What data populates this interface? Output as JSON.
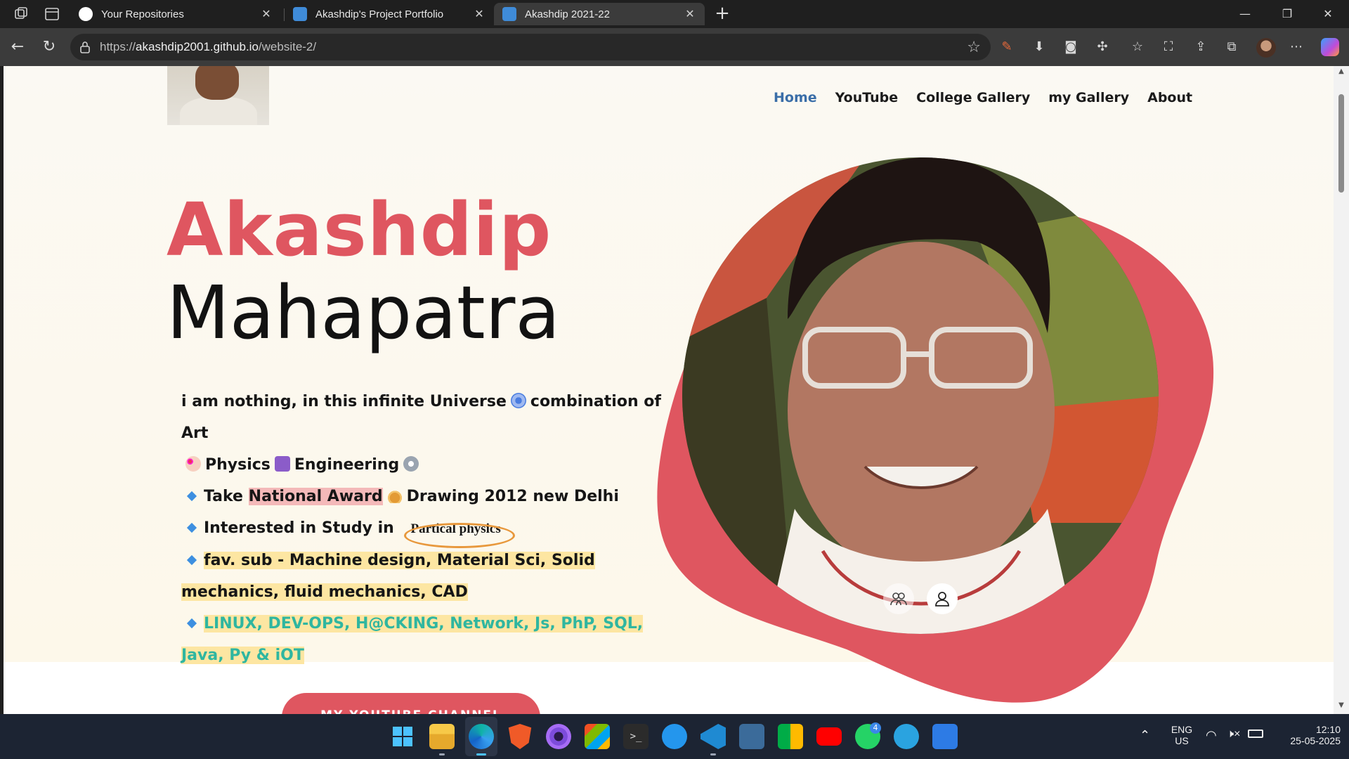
{
  "browser": {
    "tabs": [
      {
        "title": "Your Repositories",
        "active": false
      },
      {
        "title": "Akashdip's Project Portfolio",
        "active": false
      },
      {
        "title": "Akashdip 2021-22",
        "active": true
      }
    ],
    "url_scheme": "https://",
    "url_host": "akashdip2001.github.io",
    "url_path": "/website-2/"
  },
  "site": {
    "nav": [
      {
        "label": "Home",
        "active": true
      },
      {
        "label": "YouTube",
        "active": false
      },
      {
        "label": "College Gallery",
        "active": false
      },
      {
        "label": "my Gallery",
        "active": false
      },
      {
        "label": "About",
        "active": false
      }
    ],
    "name_first": "Akashdip",
    "name_last": "Mahapatra",
    "bio": {
      "line1": "i am nothing, in this infinite Universe",
      "line1b": "combination of Art",
      "line2a": "Physics",
      "line2b": "Engineering",
      "award_pre": "Take",
      "award_hl": "National Award",
      "award_post": "Drawing 2012 new Delhi",
      "study_pre": "Interested in Study in",
      "study_circled": "Partical physics",
      "fav": "fav. sub - Machine design, Material Sci, Solid mechanics, fluid mechanics, CAD",
      "skills": "LINUX, DEV-OPS, H@CKING, Network, Js, PhP, SQL, Java, Py & iOT"
    },
    "youtube_button": "MY YOUTUBE CHANNEL",
    "colors": {
      "accent": "#df5660",
      "nav_active": "#3a6ea8",
      "skills_text": "#2fb6a0"
    }
  },
  "taskbar": {
    "language": "ENG",
    "region": "US",
    "time": "12:10",
    "date": "25-05-2025",
    "whatsapp_badge": "4"
  }
}
